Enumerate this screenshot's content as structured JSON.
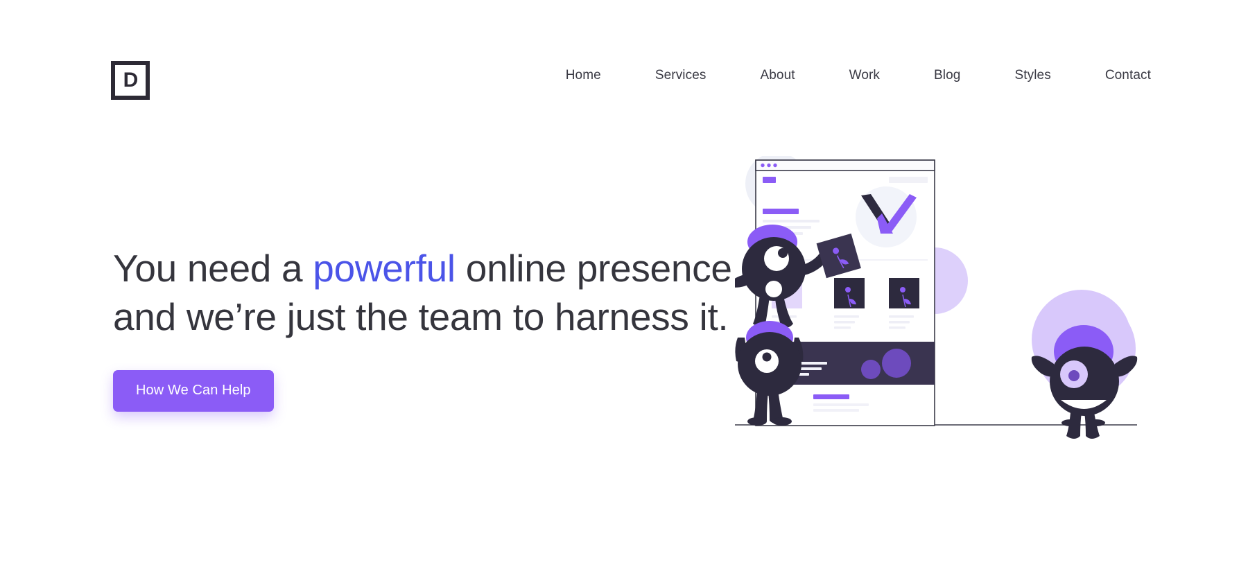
{
  "brand": {
    "logo_letter": "D",
    "logo_icon": "boxed-letter-logo"
  },
  "nav": {
    "items": [
      {
        "label": "Home"
      },
      {
        "label": "Services"
      },
      {
        "label": "About"
      },
      {
        "label": "Work"
      },
      {
        "label": "Blog"
      },
      {
        "label": "Styles"
      },
      {
        "label": "Contact"
      }
    ]
  },
  "hero": {
    "headline_line1_part1": "You need a ",
    "headline_accent": "powerful",
    "headline_line1_part2": " online presence",
    "headline_line2": "and we’re just the team to harness it.",
    "cta_label": "How We Can Help"
  },
  "illustration": {
    "name": "team-characters-with-browser-mockup",
    "browser_dots": 3,
    "cards": 3,
    "characters": [
      {
        "name": "character-holding-card",
        "eye": "one-large-eye",
        "mouth": "round"
      },
      {
        "name": "character-arms-up",
        "eye": "one-large-eye",
        "mouth": "none"
      },
      {
        "name": "character-smiling",
        "eye": "one-large-eye",
        "mouth": "smile"
      }
    ]
  },
  "colors": {
    "purple": "#8b5cf6",
    "purple_light": "#d8c8fb",
    "purple_pale": "#eee7fe",
    "dark": "#2d2a3e",
    "accent_blue": "#4b54e8",
    "text": "#35353d",
    "line_gray": "#4a4a58"
  }
}
